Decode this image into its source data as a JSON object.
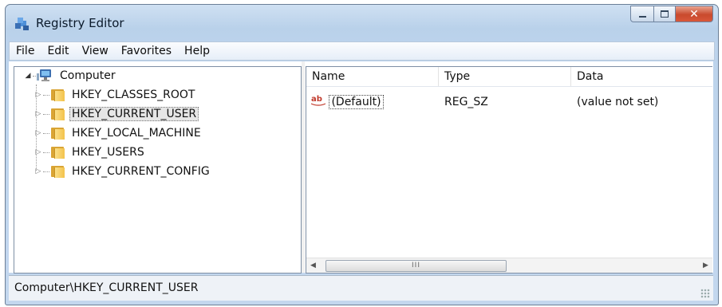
{
  "window": {
    "title": "Registry Editor"
  },
  "menu": [
    "File",
    "Edit",
    "View",
    "Favorites",
    "Help"
  ],
  "tree": {
    "root": "Computer",
    "items": [
      {
        "label": "HKEY_CLASSES_ROOT",
        "selected": false
      },
      {
        "label": "HKEY_CURRENT_USER",
        "selected": true
      },
      {
        "label": "HKEY_LOCAL_MACHINE",
        "selected": false
      },
      {
        "label": "HKEY_USERS",
        "selected": false
      },
      {
        "label": "HKEY_CURRENT_CONFIG",
        "selected": false
      }
    ]
  },
  "list": {
    "columns": [
      "Name",
      "Type",
      "Data"
    ],
    "rows": [
      {
        "name": "(Default)",
        "type": "REG_SZ",
        "data": "(value not set)",
        "icon": "string-value-icon",
        "icon_text": "ab"
      }
    ]
  },
  "scrollbar": {
    "thumb_grip": "III"
  },
  "status": {
    "path": "Computer\\HKEY_CURRENT_USER"
  },
  "colors": {
    "folder": "#f3c24b",
    "selection": "#e6e6e6",
    "close_button": "#c94a2d"
  }
}
